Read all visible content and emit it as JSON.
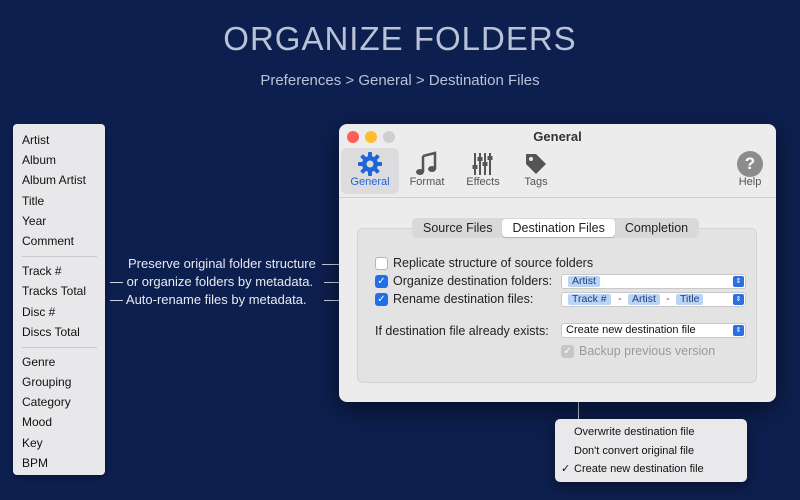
{
  "hero": {
    "title": "ORGANIZE FOLDERS",
    "subtitle": "Preferences > General > Destination Files"
  },
  "tag_list": {
    "groups": [
      [
        "Artist",
        "Album",
        "Album Artist",
        "Title",
        "Year",
        "Comment"
      ],
      [
        "Track #",
        "Tracks Total",
        "Disc #",
        "Discs Total"
      ],
      [
        "Genre",
        "Grouping",
        "Category",
        "Mood",
        "Key",
        "BPM"
      ]
    ]
  },
  "annotations": {
    "line1": "Preserve original folder structure",
    "line2": "— or organize folders by metadata.",
    "line3": "— Auto-rename files by metadata."
  },
  "window": {
    "title": "General",
    "toolbar": [
      {
        "label": "General",
        "icon": "gear-icon",
        "active": true
      },
      {
        "label": "Format",
        "icon": "music-note-icon",
        "active": false
      },
      {
        "label": "Effects",
        "icon": "sliders-icon",
        "active": false
      },
      {
        "label": "Tags",
        "icon": "tag-icon",
        "active": false
      },
      {
        "label": "Help",
        "icon": "help-icon",
        "active": false
      }
    ],
    "tabs": [
      "Source Files",
      "Destination Files",
      "Completion"
    ],
    "selected_tab": "Destination Files",
    "replicate_label": "Replicate structure of source folders",
    "replicate_checked": false,
    "organize_label": "Organize destination folders:",
    "organize_checked": true,
    "organize_tokens": [
      "Artist"
    ],
    "rename_label": "Rename destination files:",
    "rename_checked": true,
    "rename_tokens": [
      "Track #",
      "Artist",
      "Title"
    ],
    "rename_separator": "-",
    "exists_label": "If destination file already exists:",
    "exists_value": "Create new destination file",
    "backup_label": "Backup previous version",
    "backup_checked": true,
    "accent_color": "#1f6fe6"
  },
  "menu": {
    "items": [
      "Overwrite destination file",
      "Don't convert original file",
      "Create new destination file"
    ],
    "checked_index": 2
  }
}
